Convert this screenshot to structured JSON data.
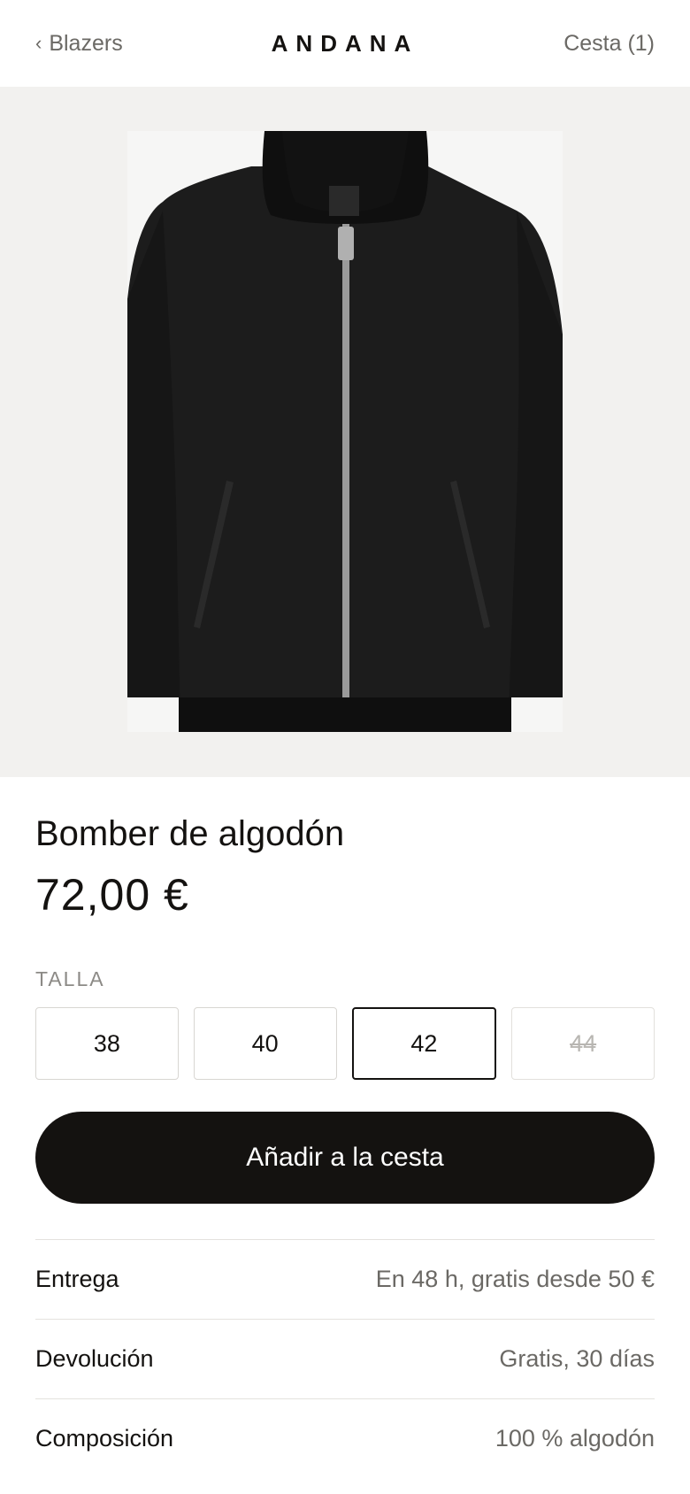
{
  "header": {
    "back_chevron": "‹",
    "back_label": "Blazers",
    "brand": "ANDANA",
    "cart_label": "Cesta (1)"
  },
  "product": {
    "image_desc": "black cotton bomber jacket",
    "title": "Bomber de algodón",
    "price": "72,00 €",
    "size_label": "TALLA",
    "sizes": [
      {
        "label": "38",
        "state": "available"
      },
      {
        "label": "40",
        "state": "available"
      },
      {
        "label": "42",
        "state": "selected"
      },
      {
        "label": "44",
        "state": "unavailable"
      }
    ],
    "add_to_cart": "Añadir a la cesta"
  },
  "details": [
    {
      "key": "Entrega",
      "value": "En 48 h, gratis desde 50 €"
    },
    {
      "key": "Devolución",
      "value": "Gratis, 30 días"
    },
    {
      "key": "Composición",
      "value": "100 % algodón"
    }
  ],
  "colors": {
    "text": "#141210",
    "muted": "#6b6965",
    "hero_bg": "#f2f1ef",
    "button_bg": "#141210"
  }
}
